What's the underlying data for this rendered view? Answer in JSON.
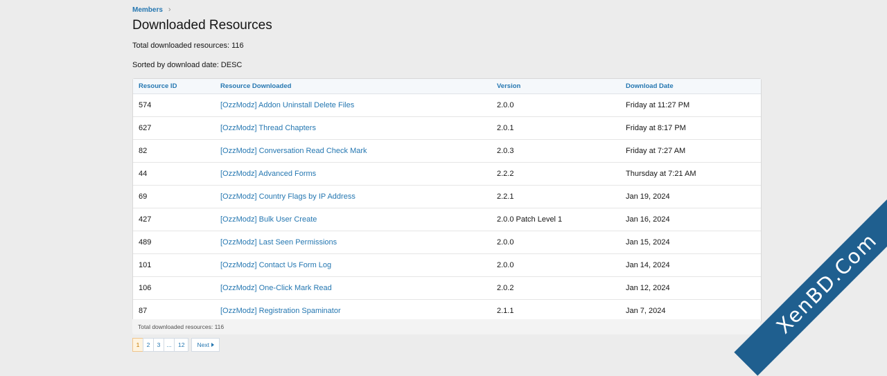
{
  "breadcrumb": {
    "item": "Members"
  },
  "page_title": "Downloaded Resources",
  "total_text": "Total downloaded resources: 116",
  "sorted_text": "Sorted by download date: DESC",
  "table": {
    "headers": [
      "Resource ID",
      "Resource Downloaded",
      "Version",
      "Download Date"
    ],
    "rows": [
      {
        "id": "574",
        "resource": "[OzzModz] Addon Uninstall Delete Files",
        "version": "2.0.0",
        "date": "Friday at 11:27 PM"
      },
      {
        "id": "627",
        "resource": "[OzzModz] Thread Chapters",
        "version": "2.0.1",
        "date": "Friday at 8:17 PM"
      },
      {
        "id": "82",
        "resource": "[OzzModz] Conversation Read Check Mark",
        "version": "2.0.3",
        "date": "Friday at 7:27 AM"
      },
      {
        "id": "44",
        "resource": "[OzzModz] Advanced Forms",
        "version": "2.2.2",
        "date": "Thursday at 7:21 AM"
      },
      {
        "id": "69",
        "resource": "[OzzModz] Country Flags by IP Address",
        "version": "2.2.1",
        "date": "Jan 19, 2024"
      },
      {
        "id": "427",
        "resource": "[OzzModz] Bulk User Create",
        "version": "2.0.0 Patch Level 1",
        "date": "Jan 16, 2024"
      },
      {
        "id": "489",
        "resource": "[OzzModz] Last Seen Permissions",
        "version": "2.0.0",
        "date": "Jan 15, 2024"
      },
      {
        "id": "101",
        "resource": "[OzzModz] Contact Us Form Log",
        "version": "2.0.0",
        "date": "Jan 14, 2024"
      },
      {
        "id": "106",
        "resource": "[OzzModz] One-Click Mark Read",
        "version": "2.0.2",
        "date": "Jan 12, 2024"
      },
      {
        "id": "87",
        "resource": "[OzzModz] Registration Spaminator",
        "version": "2.1.1",
        "date": "Jan 7, 2024"
      }
    ]
  },
  "footer_text": "Total downloaded resources: 116",
  "pager": {
    "pages": [
      "1",
      "2",
      "3",
      "...",
      "12"
    ],
    "current": "1",
    "next_label": "Next"
  },
  "watermark": "XenBD.Com",
  "colors": {
    "link": "#2577b1",
    "ribbon": "#1f5f8f",
    "current_page": "#fef3df"
  }
}
